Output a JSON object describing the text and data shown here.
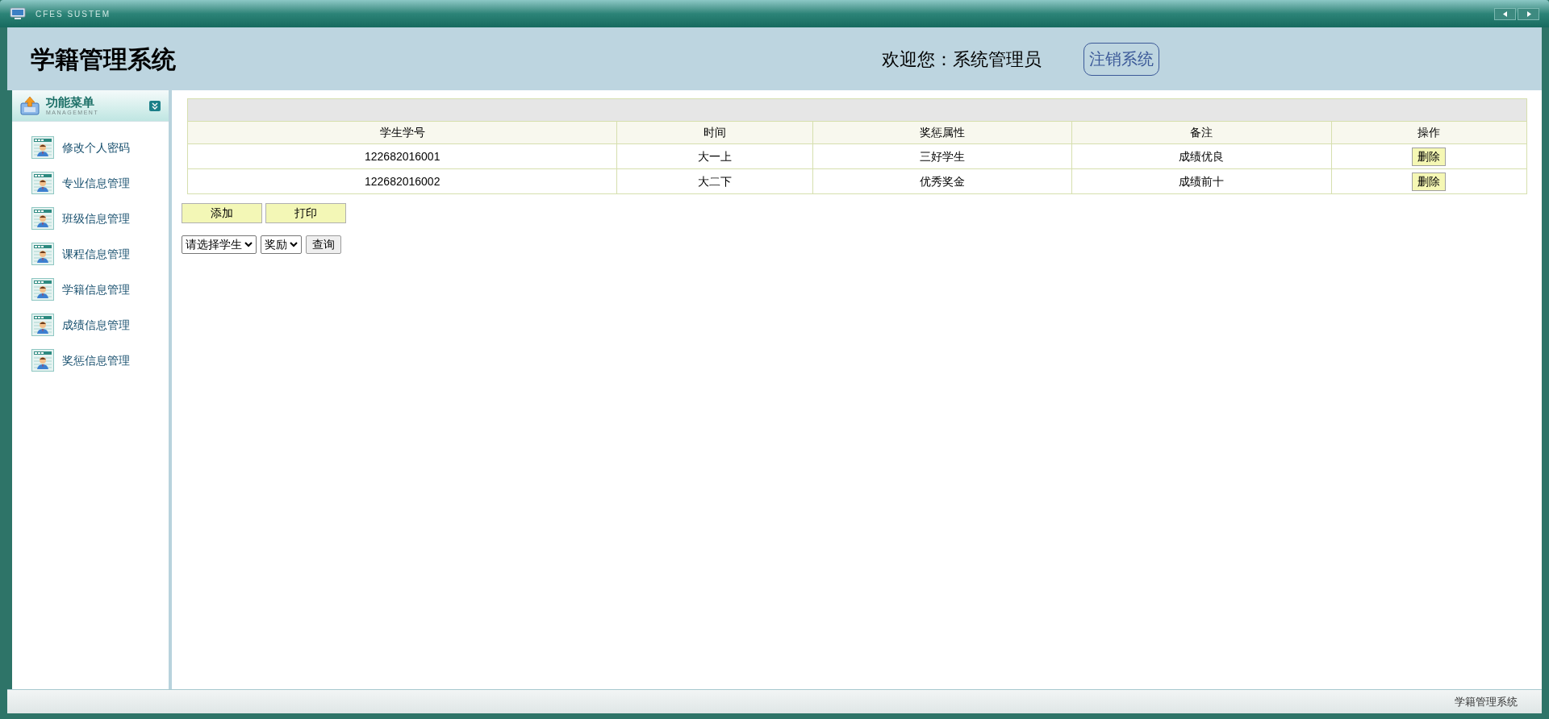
{
  "window": {
    "title": "CFES SUSTEM"
  },
  "header": {
    "title": "学籍管理系统",
    "welcome": "欢迎您：系统管理员",
    "logout": "注销系统"
  },
  "sidebar": {
    "title": "功能菜单",
    "subtitle": "MANAGEMENT",
    "items": [
      {
        "label": "修改个人密码"
      },
      {
        "label": "专业信息管理"
      },
      {
        "label": "班级信息管理"
      },
      {
        "label": "课程信息管理"
      },
      {
        "label": "学籍信息管理"
      },
      {
        "label": "成绩信息管理"
      },
      {
        "label": "奖惩信息管理"
      }
    ]
  },
  "table": {
    "columns": [
      "学生学号",
      "时间",
      "奖惩属性",
      "备注",
      "操作"
    ],
    "rows": [
      {
        "cells": [
          "122682016001",
          "大一上",
          "三好学生",
          "成绩优良"
        ],
        "action": "删除"
      },
      {
        "cells": [
          "122682016002",
          "大二下",
          "优秀奖金",
          "成绩前十"
        ],
        "action": "删除"
      }
    ]
  },
  "buttons": [
    "添加",
    "打印"
  ],
  "filters": {
    "student": "请选择学生",
    "type": "奖励",
    "query": "查询"
  },
  "status_bar": "学籍管理系统"
}
